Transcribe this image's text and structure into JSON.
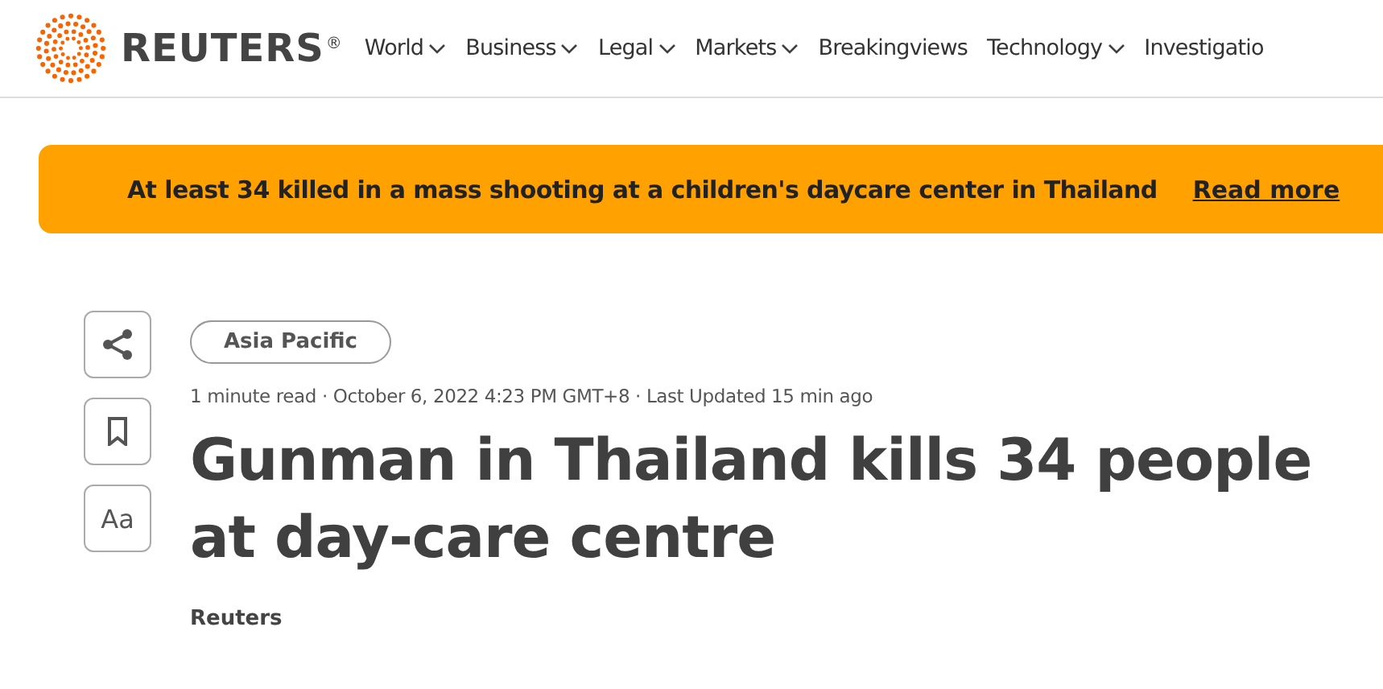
{
  "header": {
    "brand": "REUTERS",
    "brand_mark": "®",
    "nav": [
      {
        "label": "World",
        "dropdown": true
      },
      {
        "label": "Business",
        "dropdown": true
      },
      {
        "label": "Legal",
        "dropdown": true
      },
      {
        "label": "Markets",
        "dropdown": true
      },
      {
        "label": "Breakingviews",
        "dropdown": false
      },
      {
        "label": "Technology",
        "dropdown": true
      },
      {
        "label": "Investigatio",
        "dropdown": false
      }
    ]
  },
  "alert": {
    "text": "At least 34 killed in a mass shooting at a children's daycare center in Thailand",
    "link": "Read more"
  },
  "tools": [
    {
      "kind": "share"
    },
    {
      "kind": "bookmark"
    },
    {
      "kind": "text",
      "label": "Aa"
    }
  ],
  "article": {
    "section": "Asia Pacific",
    "meta": "1 minute read · October 6, 2022 4:23 PM GMT+8 · Last Updated 15 min ago",
    "headline": "Gunman in Thailand kills 34 people at day-care centre",
    "byline": "Reuters"
  }
}
